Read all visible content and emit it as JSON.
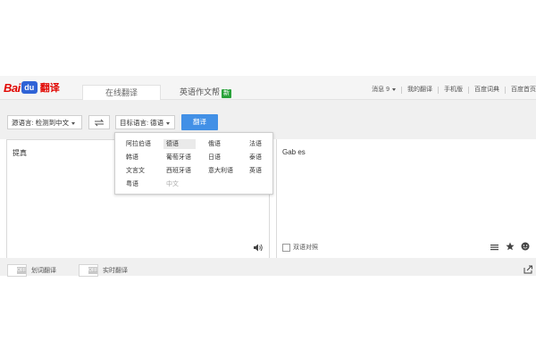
{
  "header": {
    "logo": {
      "part1": "Bai",
      "part2": "du",
      "part3": "翻译"
    },
    "tabs": [
      {
        "label": "在线翻译"
      },
      {
        "label": "英语作文帮",
        "badge": "新"
      }
    ],
    "links": [
      "消息 9",
      "我的翻译",
      "手机版",
      "百度词典",
      "百度首页"
    ]
  },
  "toolbar": {
    "source_lang": "源语言: 检测到中文",
    "target_lang": "目标语言: 德语",
    "translate_label": "翻译"
  },
  "source": {
    "text": "提真"
  },
  "result": {
    "text": "Gab es",
    "bilingual_label": "双语对照"
  },
  "bottom": {
    "toggle1": {
      "knob": "OFF",
      "label": "划词翻译"
    },
    "toggle2": {
      "knob": "OFF",
      "label": "实时翻译"
    }
  },
  "language_dropdown": {
    "selected": "德语",
    "items": [
      [
        "阿拉伯语",
        "德语",
        "俄语",
        "法语"
      ],
      [
        "韩语",
        "葡萄牙语",
        "日语",
        "泰语"
      ],
      [
        "文言文",
        "西班牙语",
        "意大利语",
        "英语"
      ],
      [
        "粤语",
        "中文"
      ]
    ]
  },
  "colors": {
    "brand_red": "#e10601",
    "brand_blue": "#2f63d6",
    "button_blue": "#4290e6",
    "badge_green": "#29a23a"
  }
}
